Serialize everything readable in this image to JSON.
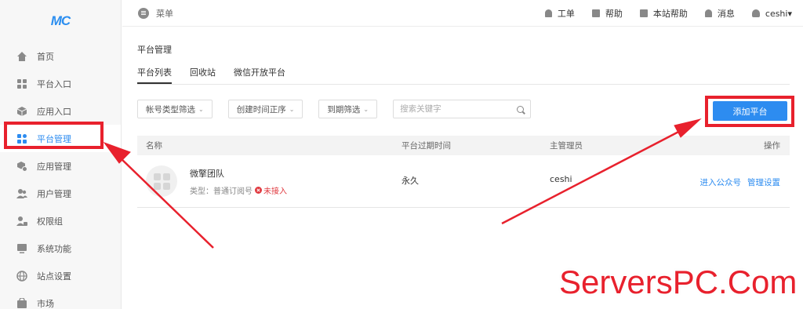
{
  "logo": "MC",
  "sidebar": {
    "items": [
      {
        "label": "首页",
        "icon": "home-icon"
      },
      {
        "label": "平台入口",
        "icon": "grid-icon"
      },
      {
        "label": "应用入口",
        "icon": "cube-icon"
      },
      {
        "label": "平台管理",
        "icon": "apps-icon",
        "active": true
      },
      {
        "label": "应用管理",
        "icon": "box-settings-icon"
      },
      {
        "label": "用户管理",
        "icon": "users-icon"
      },
      {
        "label": "权限组",
        "icon": "user-lock-icon"
      },
      {
        "label": "系统功能",
        "icon": "monitor-icon"
      },
      {
        "label": "站点设置",
        "icon": "globe-icon"
      },
      {
        "label": "市场",
        "icon": "shop-icon"
      }
    ]
  },
  "topbar": {
    "menu_label": "菜单",
    "links": [
      {
        "label": "工单",
        "icon": "bell-icon"
      },
      {
        "label": "帮助",
        "icon": "bag-icon"
      },
      {
        "label": "本站帮助",
        "icon": "bag-icon"
      },
      {
        "label": "消息",
        "icon": "bell-icon"
      }
    ],
    "user": "ceshi▾"
  },
  "main": {
    "title": "平台管理",
    "tabs": [
      "平台列表",
      "回收站",
      "微信开放平台"
    ],
    "filters": [
      "帐号类型筛选",
      "创建时间正序",
      "到期筛选"
    ],
    "filter_caret": "⌄",
    "search_placeholder": "搜索关键字",
    "add_button": "添加平台",
    "table": {
      "headers": {
        "name": "名称",
        "expire": "平台过期时间",
        "admin": "主管理员",
        "ops": "操作"
      },
      "rows": [
        {
          "name": "微擎团队",
          "type": "类型：普通订阅号",
          "status": "未接入",
          "expire": "永久",
          "admin": "ceshi",
          "ops": [
            "进入公众号",
            "管理设置"
          ]
        }
      ]
    }
  },
  "watermark": "ServersPC.Com",
  "colors": {
    "accent": "#2d8cf0",
    "highlight": "#e8212d"
  }
}
